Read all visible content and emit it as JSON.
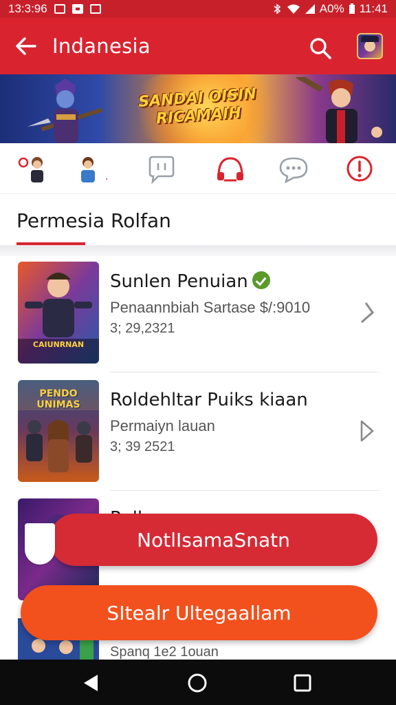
{
  "status_bar": {
    "time": "13:3:96",
    "battery": "A0%",
    "clock_right": "11:41"
  },
  "app_bar": {
    "title": "Indanesia"
  },
  "banner": {
    "title_line1": "SANDAI OISIN",
    "title_line2": "RICAMAIH"
  },
  "shortcuts": [
    {
      "name": "shortcut-avatar-1"
    },
    {
      "name": "shortcut-avatar-2"
    },
    {
      "name": "shortcut-chat"
    },
    {
      "name": "shortcut-support"
    },
    {
      "name": "shortcut-messages"
    },
    {
      "name": "shortcut-alert"
    }
  ],
  "section": {
    "title": "Permesia Rolfan"
  },
  "items": [
    {
      "title": "Sunlen Penuian",
      "subtitle": "Penaannbiah Sartase $/:9010",
      "meta": "3; 29,2321",
      "thumb_caption": "CAIUNRNAN",
      "verified": true
    },
    {
      "title": "Roldehltar Puiks kiaan",
      "subtitle": "Permaiyn lauan",
      "meta": "3; 39 2521",
      "thumb_caption": "PENDO UNIMAS",
      "verified": false
    },
    {
      "title": "Rolban ... ",
      "subtitle": "",
      "meta": "",
      "thumb_caption": "",
      "verified": false
    }
  ],
  "buttons": {
    "primary": "NotlIsamaSnatn",
    "secondary": "SItealr Ultegaallam"
  },
  "peek_meta": "Spanq 1e2 1ouan",
  "colors": {
    "brand_red": "#d9242f",
    "button_orange": "#f2511e",
    "verified_green": "#5b9a2a"
  }
}
